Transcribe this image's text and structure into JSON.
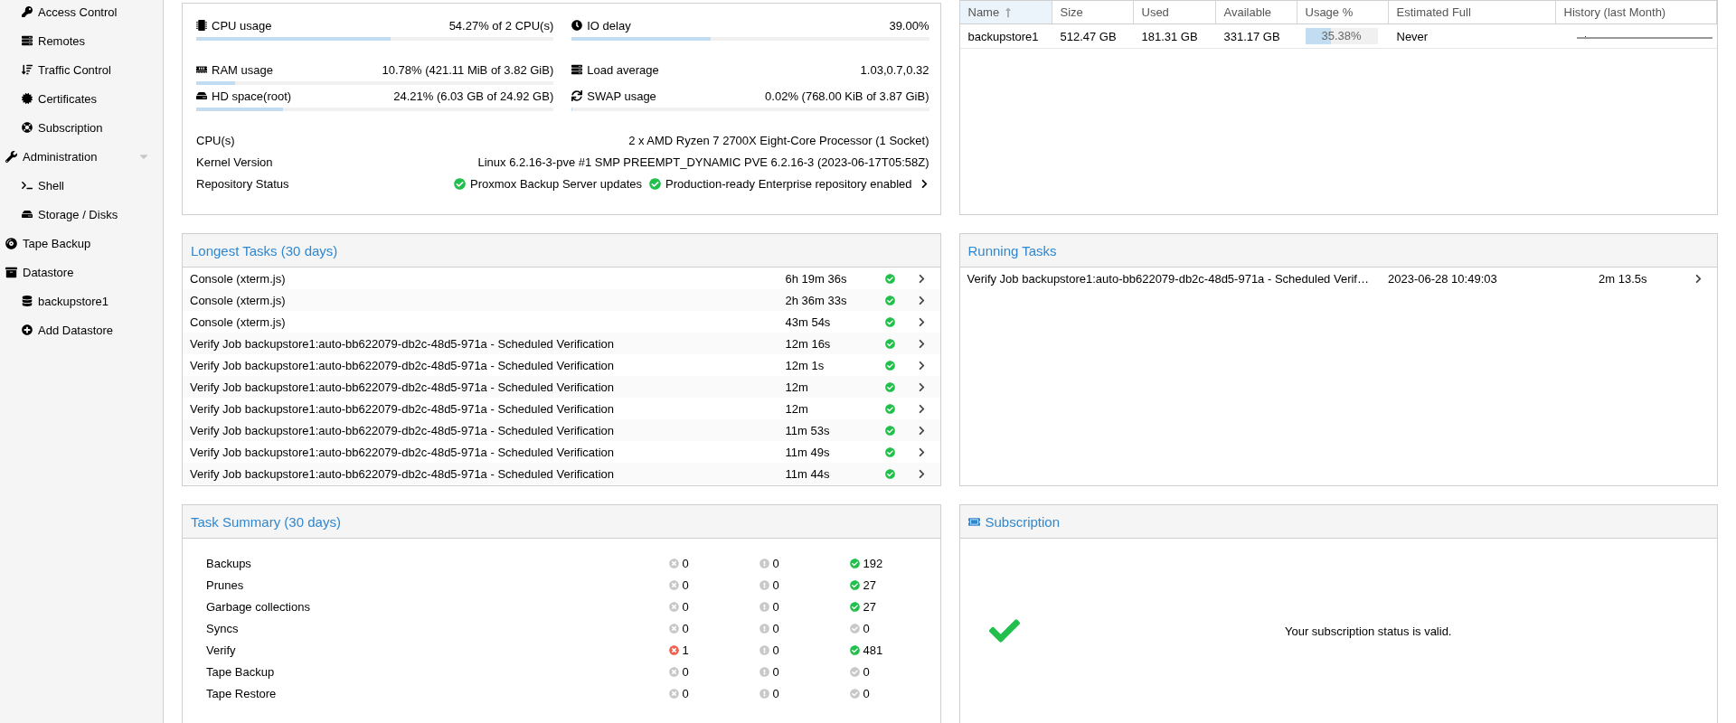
{
  "sidebar": {
    "continued_children": [
      {
        "label": "Access Control",
        "selected": false
      },
      {
        "label": "Remotes",
        "selected": false
      },
      {
        "label": "Traffic Control",
        "selected": false
      },
      {
        "label": "Certificates",
        "selected": false
      },
      {
        "label": "Subscription",
        "selected": false
      }
    ],
    "items": [
      {
        "label": "Administration",
        "kind": "toggle",
        "selected": false,
        "children": [
          {
            "label": "Shell",
            "selected": false
          },
          {
            "label": "Storage / Disks",
            "selected": false
          }
        ]
      },
      {
        "label": "Tape Backup",
        "kind": "plain",
        "selected": false
      },
      {
        "label": "Datastore",
        "kind": "plain",
        "selected": false,
        "children": [
          {
            "label": "backupstore1",
            "selected": false
          },
          {
            "label": "Add Datastore",
            "selected": false
          }
        ]
      }
    ]
  },
  "status": {
    "metrics": [
      {
        "label": "CPU usage",
        "reading": "54.27% of 2 CPU(s)",
        "kind": "bar",
        "level": 0.5427
      },
      {
        "label": "IO delay",
        "reading": "39.00%",
        "kind": "bar",
        "level": 0.39
      },
      {
        "label": "RAM usage",
        "reading": "10.78% (421.11 MiB of 3.82 GiB)",
        "kind": "bar",
        "level": 0.1078
      },
      {
        "label": "Load average",
        "reading": "1.03,0.7,0.32",
        "kind": "text"
      },
      {
        "label": "HD space(root)",
        "reading": "24.21% (6.03 GB of 24.92 GB)",
        "kind": "bar",
        "level": 0.2421
      },
      {
        "label": "SWAP usage",
        "reading": "0.02% (768.00 KiB of 3.87 GiB)",
        "kind": "bar",
        "level": 0.0002
      }
    ],
    "info": [
      {
        "label": "CPU(s)",
        "value": "2 x AMD Ryzen 7 2700X Eight-Core Processor (1 Socket)"
      },
      {
        "label": "Kernel Version",
        "value": "Linux 6.2.16-3-pve #1 SMP PREEMPT_DYNAMIC PVE 6.2.16-3 (2023-06-17T05:58Z)"
      }
    ],
    "repository": {
      "label": "Repository Status",
      "items": [
        "Proxmox Backup Server updates",
        "Production-ready Enterprise repository enabled"
      ]
    }
  },
  "datastores": {
    "columns": [
      {
        "label": "Name",
        "sorted": true
      },
      {
        "label": "Size",
        "sorted": false
      },
      {
        "label": "Used",
        "sorted": false
      },
      {
        "label": "Available",
        "sorted": false
      },
      {
        "label": "Usage %",
        "sorted": false
      },
      {
        "label": "Estimated Full",
        "sorted": false
      },
      {
        "label": "History (last Month)",
        "sorted": false
      }
    ],
    "rows": [
      {
        "name": "backupstore1",
        "size": "512.47 GB",
        "used": "181.31 GB",
        "available": "331.17 GB",
        "usage": "35.38%",
        "level": 0.3538,
        "estimated_full": "Never"
      }
    ]
  },
  "longest_tasks": {
    "title": "Longest Tasks (30 days)",
    "rows": [
      {
        "name": "Console (xterm.js)",
        "duration": "6h 19m 36s"
      },
      {
        "name": "Console (xterm.js)",
        "duration": "2h 36m 33s"
      },
      {
        "name": "Console (xterm.js)",
        "duration": "43m 54s"
      },
      {
        "name": "Verify Job backupstore1:auto-bb622079-db2c-48d5-971a - Scheduled Verification",
        "duration": "12m 16s"
      },
      {
        "name": "Verify Job backupstore1:auto-bb622079-db2c-48d5-971a - Scheduled Verification",
        "duration": "12m 1s"
      },
      {
        "name": "Verify Job backupstore1:auto-bb622079-db2c-48d5-971a - Scheduled Verification",
        "duration": "12m"
      },
      {
        "name": "Verify Job backupstore1:auto-bb622079-db2c-48d5-971a - Scheduled Verification",
        "duration": "12m"
      },
      {
        "name": "Verify Job backupstore1:auto-bb622079-db2c-48d5-971a - Scheduled Verification",
        "duration": "11m 53s"
      },
      {
        "name": "Verify Job backupstore1:auto-bb622079-db2c-48d5-971a - Scheduled Verification",
        "duration": "11m 49s"
      },
      {
        "name": "Verify Job backupstore1:auto-bb622079-db2c-48d5-971a - Scheduled Verification",
        "duration": "11m 44s"
      }
    ]
  },
  "running_tasks": {
    "title": "Running Tasks",
    "rows": [
      {
        "name": "Verify Job backupstore1:auto-bb622079-db2c-48d5-971a - Scheduled Verif…",
        "started": "2023-06-28 10:49:03",
        "duration": "2m 13.5s"
      }
    ]
  },
  "task_summary": {
    "title": "Task Summary (30 days)",
    "rows": [
      {
        "label": "Backups",
        "counts": [
          {
            "value": "0",
            "active": false
          },
          {
            "value": "0",
            "active": false
          },
          {
            "value": "192",
            "active": true
          }
        ]
      },
      {
        "label": "Prunes",
        "counts": [
          {
            "value": "0",
            "active": false
          },
          {
            "value": "0",
            "active": false
          },
          {
            "value": "27",
            "active": true
          }
        ]
      },
      {
        "label": "Garbage collections",
        "counts": [
          {
            "value": "0",
            "active": false
          },
          {
            "value": "0",
            "active": false
          },
          {
            "value": "27",
            "active": true
          }
        ]
      },
      {
        "label": "Syncs",
        "counts": [
          {
            "value": "0",
            "active": false
          },
          {
            "value": "0",
            "active": false
          },
          {
            "value": "0",
            "active": false
          }
        ]
      },
      {
        "label": "Verify",
        "counts": [
          {
            "value": "1",
            "active": true
          },
          {
            "value": "0",
            "active": false
          },
          {
            "value": "481",
            "active": true
          }
        ]
      },
      {
        "label": "Tape Backup",
        "counts": [
          {
            "value": "0",
            "active": false
          },
          {
            "value": "0",
            "active": false
          },
          {
            "value": "0",
            "active": false
          }
        ]
      },
      {
        "label": "Tape Restore",
        "counts": [
          {
            "value": "0",
            "active": false
          },
          {
            "value": "0",
            "active": false
          },
          {
            "value": "0",
            "active": false
          }
        ]
      }
    ]
  },
  "subscription": {
    "title": "Subscription",
    "valid": true,
    "message": "Your subscription status is valid."
  }
}
